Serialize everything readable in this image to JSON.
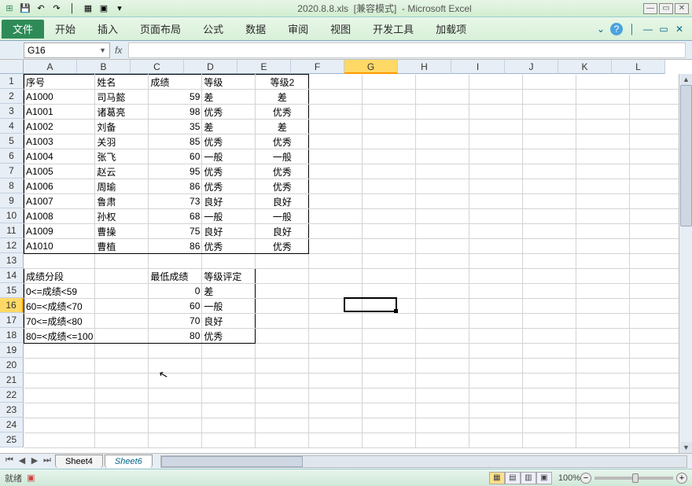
{
  "title": {
    "file": "2020.8.8.xls",
    "mode": "[兼容模式]",
    "app": "Microsoft Excel"
  },
  "ribbon": {
    "file": "文件",
    "tabs": [
      "开始",
      "插入",
      "页面布局",
      "公式",
      "数据",
      "审阅",
      "视图",
      "开发工具",
      "加载项"
    ],
    "help": "?"
  },
  "namebox": "G16",
  "fx": "fx",
  "columns": [
    "A",
    "B",
    "C",
    "D",
    "E",
    "F",
    "G",
    "H",
    "I",
    "J",
    "K",
    "L"
  ],
  "rows": [
    "1",
    "2",
    "3",
    "4",
    "5",
    "6",
    "7",
    "8",
    "9",
    "10",
    "11",
    "12",
    "13",
    "14",
    "15",
    "16",
    "17",
    "18",
    "19",
    "20",
    "21",
    "22",
    "23",
    "24",
    "25"
  ],
  "selected": {
    "col": "G",
    "row": "16"
  },
  "table1": {
    "headers": [
      "序号",
      "姓名",
      "成绩",
      "等级",
      "等级2"
    ],
    "rows": [
      [
        "A1000",
        "司马懿",
        "59",
        "差",
        "差"
      ],
      [
        "A1001",
        "诸葛亮",
        "98",
        "优秀",
        "优秀"
      ],
      [
        "A1002",
        "刘备",
        "35",
        "差",
        "差"
      ],
      [
        "A1003",
        "关羽",
        "85",
        "优秀",
        "优秀"
      ],
      [
        "A1004",
        "张飞",
        "60",
        "一般",
        "一般"
      ],
      [
        "A1005",
        "赵云",
        "95",
        "优秀",
        "优秀"
      ],
      [
        "A1006",
        "周瑜",
        "86",
        "优秀",
        "优秀"
      ],
      [
        "A1007",
        "鲁肃",
        "73",
        "良好",
        "良好"
      ],
      [
        "A1008",
        "孙权",
        "68",
        "一般",
        "一般"
      ],
      [
        "A1009",
        "曹操",
        "75",
        "良好",
        "良好"
      ],
      [
        "A1010",
        "曹植",
        "86",
        "优秀",
        "优秀"
      ]
    ]
  },
  "table2": {
    "headers": [
      "成绩分段",
      "最低成绩",
      "等级评定"
    ],
    "rows": [
      [
        "0<=成绩<59",
        "0",
        "差"
      ],
      [
        "60=<成绩<70",
        "60",
        "一般"
      ],
      [
        "70<=成绩<80",
        "70",
        "良好"
      ],
      [
        "80=<成绩<=100",
        "80",
        "优秀"
      ]
    ]
  },
  "sheet_tabs": [
    "Sheet4",
    "Sheet6"
  ],
  "active_sheet": 1,
  "status": {
    "ready": "就绪",
    "macro_icon": "▣",
    "zoom_pct": "100%"
  }
}
